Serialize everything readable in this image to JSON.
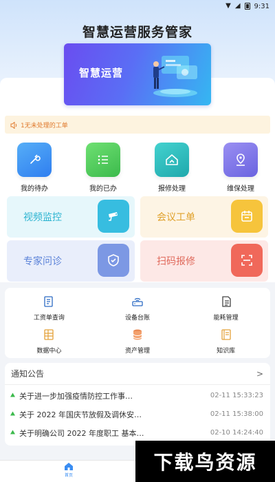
{
  "status_bar": {
    "time": "9:31",
    "icons": [
      "wifi-icon",
      "signal-icon",
      "battery-icon"
    ]
  },
  "app": {
    "title": "智慧运营服务管家"
  },
  "banner": {
    "text": "智慧运营"
  },
  "notice": {
    "text": "1无未处理的工单",
    "icon": "speaker-icon",
    "color": "#e07a2e"
  },
  "quick_actions": [
    {
      "label": "我的待办",
      "icon": "wrench-icon",
      "color": "#3a8df2"
    },
    {
      "label": "我的已办",
      "icon": "list-icon",
      "color": "#4cc45a"
    },
    {
      "label": "报修处理",
      "icon": "house-icon",
      "color": "#27b6b8"
    },
    {
      "label": "维保处理",
      "icon": "location-icon",
      "color": "#7b74e8"
    }
  ],
  "tiles": [
    {
      "label": "视频监控",
      "icon": "camera-icon",
      "text_color": "#2ab3d0",
      "bg": "#e6f7fb",
      "icon_bg": "#37bde0"
    },
    {
      "label": "会议工单",
      "icon": "calendar-icon",
      "text_color": "#e0a12a",
      "bg": "#fdf4e4",
      "icon_bg": "#f6c43c"
    },
    {
      "label": "专家问诊",
      "icon": "shield-icon",
      "text_color": "#5b82d8",
      "bg": "#e9eefb",
      "icon_bg": "#7c98e4"
    },
    {
      "label": "扫码报修",
      "icon": "scan-icon",
      "text_color": "#e06a5c",
      "bg": "#fde8e6",
      "icon_bg": "#f0685a"
    }
  ],
  "functions": [
    {
      "label": "工资单查询",
      "icon": "payslip-icon"
    },
    {
      "label": "设备台账",
      "icon": "router-icon"
    },
    {
      "label": "能耗管理",
      "icon": "document-icon"
    },
    {
      "label": "数据中心",
      "icon": "data-table-icon"
    },
    {
      "label": "资产管理",
      "icon": "database-icon"
    },
    {
      "label": "知识库",
      "icon": "book-icon"
    }
  ],
  "news": {
    "title": "通知公告",
    "more": ">",
    "items": [
      {
        "text": "关于进一步加强疫情防控工作事…",
        "time": "02-11 15:33:23"
      },
      {
        "text": "关于 2022 年国庆节放假及调休安…",
        "time": "02-11 15:38:00"
      },
      {
        "text": "关于明确公司 2022 年度职工 基本…",
        "time": "02-10 14:24:40"
      }
    ]
  },
  "tabbar": {
    "home_label": "首页"
  },
  "watermark": {
    "text": "下载鸟资源"
  }
}
